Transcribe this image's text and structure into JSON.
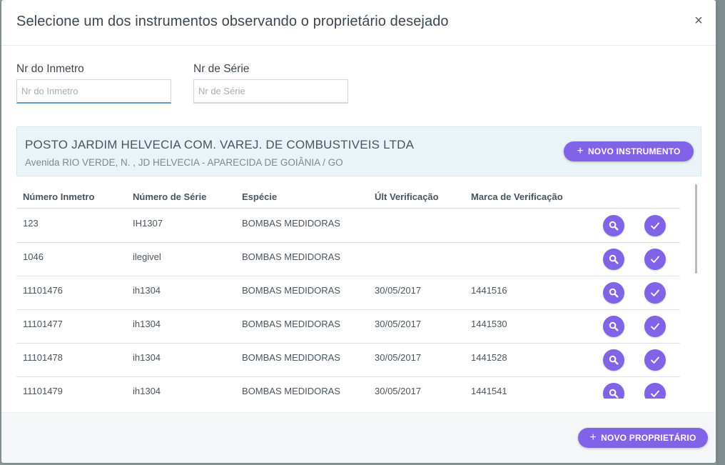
{
  "modal": {
    "title": "Selecione um dos instrumentos observando o proprietário desejado",
    "close_label": "×"
  },
  "filters": {
    "inmetro": {
      "label": "Nr do Inmetro",
      "placeholder": "Nr do Inmetro",
      "value": ""
    },
    "serie": {
      "label": "Nr de Série",
      "placeholder": "Nr de Série",
      "value": ""
    }
  },
  "owner": {
    "name": "POSTO JARDIM HELVECIA COM. VAREJ. DE COMBUSTIVEIS LTDA",
    "address": "Avenida RIO VERDE, N. , JD HELVECIA - APARECIDA DE GOIÂNIA / GO",
    "new_instrument_label": "NOVO INSTRUMENTO"
  },
  "table": {
    "headers": {
      "inmetro": "Número Inmetro",
      "serie": "Número de Série",
      "especie": "Espécie",
      "verificacao": "Últ Verificação",
      "marca": "Marca de Verificação"
    },
    "rows": [
      {
        "inmetro": "123",
        "serie": "IH1307",
        "especie": "BOMBAS MEDIDORAS",
        "verificacao": "",
        "marca": ""
      },
      {
        "inmetro": "1046",
        "serie": "ilegivel",
        "especie": "BOMBAS MEDIDORAS",
        "verificacao": "",
        "marca": ""
      },
      {
        "inmetro": "11101476",
        "serie": "ih1304",
        "especie": "BOMBAS MEDIDORAS",
        "verificacao": "30/05/2017",
        "marca": "1441516"
      },
      {
        "inmetro": "11101477",
        "serie": "ih1304",
        "especie": "BOMBAS MEDIDORAS",
        "verificacao": "30/05/2017",
        "marca": "1441530"
      },
      {
        "inmetro": "11101478",
        "serie": "ih1304",
        "especie": "BOMBAS MEDIDORAS",
        "verificacao": "30/05/2017",
        "marca": "1441528"
      },
      {
        "inmetro": "11101479",
        "serie": "ih1304",
        "especie": "BOMBAS MEDIDORAS",
        "verificacao": "30/05/2017",
        "marca": "1441541"
      }
    ]
  },
  "footer": {
    "new_owner_label": "NOVO PROPRIETÁRIO"
  },
  "icons": {
    "view": "search-icon",
    "select": "check-icon",
    "add": "plus-icon",
    "close": "close-icon"
  },
  "colors": {
    "accent": "#8163e8",
    "owner_background": "#eaf3f8",
    "input_focus": "#5b9bd5"
  }
}
